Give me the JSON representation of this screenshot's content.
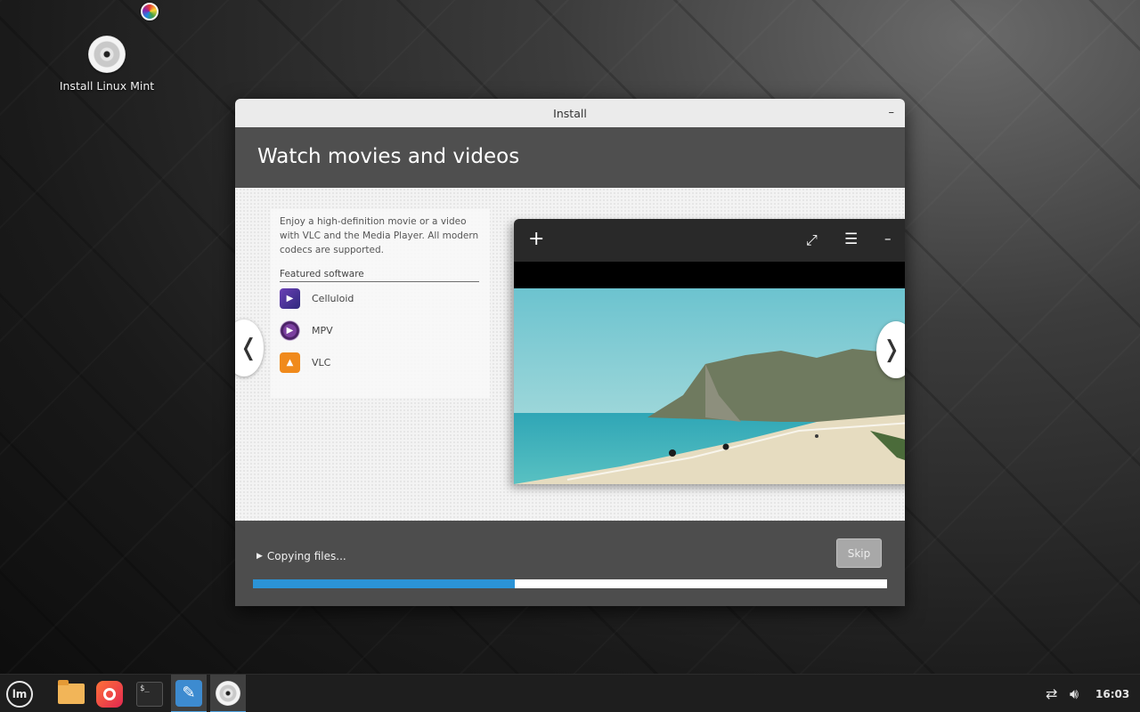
{
  "desktop": {
    "icon_label": "Install Linux Mint"
  },
  "window": {
    "title": "Install",
    "minimize_glyph": "–",
    "header_title": "Watch movies and videos",
    "description": "Enjoy a high-definition movie or a video with VLC and the Media Player. All modern codecs are supported.",
    "featured_label": "Featured software",
    "apps": [
      {
        "name": "Celluloid",
        "icon": "celluloid-icon"
      },
      {
        "name": "MPV",
        "icon": "mpv-icon"
      },
      {
        "name": "VLC",
        "icon": "vlc-icon"
      }
    ],
    "prev_glyph": "❬",
    "next_glyph": "❭",
    "player": {
      "plus_glyph": "+",
      "fullscreen_glyph": "⤢",
      "menu_glyph": "☰",
      "minimize_glyph": "–"
    },
    "status_text": "Copying files...",
    "skip_label": "Skip",
    "progress_percent": 41.3
  },
  "colors": {
    "accent": "#2b93d6",
    "header_bg": "#4f4f4f",
    "titlebar_bg": "#ebebeb"
  },
  "taskbar": {
    "apps": [
      "mint-menu",
      "files",
      "firefox",
      "terminal",
      "text-editor",
      "installer"
    ],
    "clock": "16:03"
  }
}
